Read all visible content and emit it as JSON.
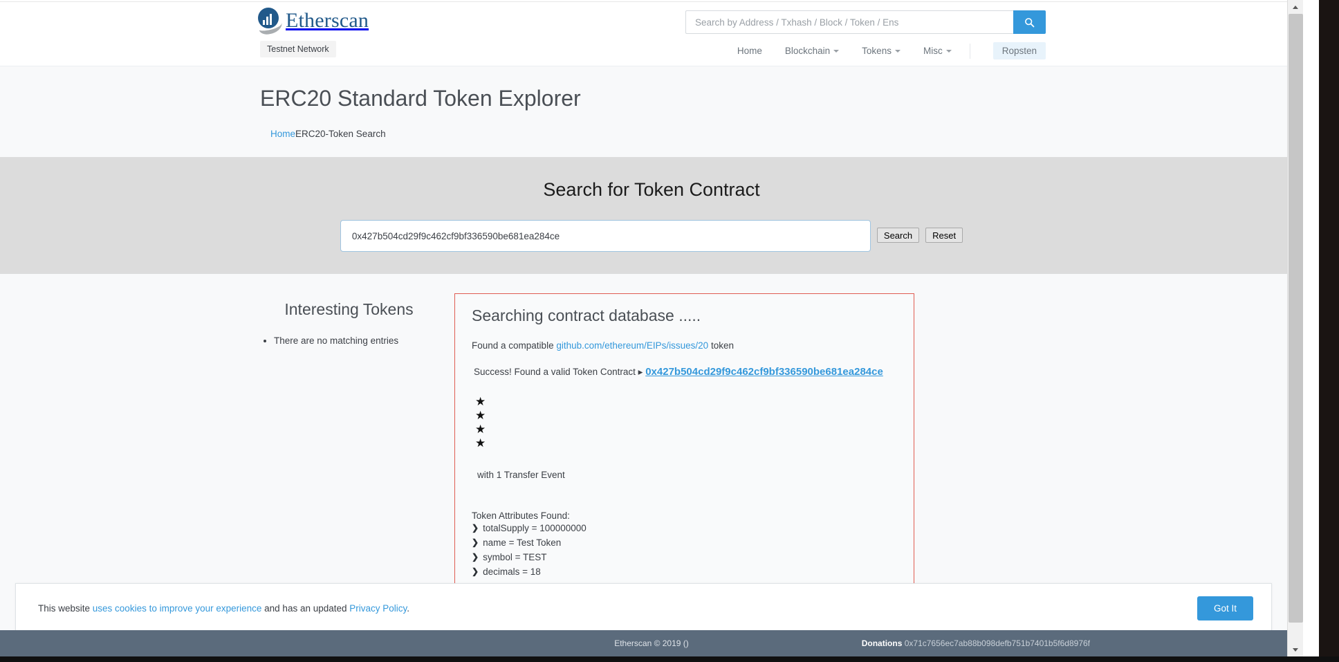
{
  "header": {
    "logo_text": "Etherscan",
    "testnet_badge": "Testnet Network",
    "search_placeholder": "Search by Address / Txhash / Block / Token / Ens",
    "search_value": "",
    "search_icon": "search-icon",
    "nav": [
      {
        "label": "Home",
        "has_caret": false
      },
      {
        "label": "Blockchain",
        "has_caret": true
      },
      {
        "label": "Tokens",
        "has_caret": true
      },
      {
        "label": "Misc",
        "has_caret": true
      }
    ],
    "network_badge": "Ropsten"
  },
  "title_band": {
    "page_title": "ERC20 Standard Token Explorer",
    "breadcrumb_home": "Home",
    "breadcrumb_current": "ERC20-Token Search"
  },
  "search_panel": {
    "heading": "Search for Token Contract",
    "input_value": "0x427b504cd29f9c462cf9bf336590be681ea284ce",
    "input_placeholder": "",
    "search_button": "Search",
    "reset_button": "Reset"
  },
  "interesting_tokens": {
    "heading": "Interesting Tokens",
    "items": [
      "There are no matching entries"
    ]
  },
  "result": {
    "heading": "Searching contract database .....",
    "found_prefix": "Found a compatible ",
    "found_link": "github.com/ethereum/EIPs/issues/20",
    "found_suffix": " token",
    "success_text": "Success! Found a valid Token Contract",
    "success_arrow": "▸",
    "contract_address": "0x427b504cd29f9c462cf9bf336590be681ea284ce",
    "stars": [
      "★",
      "★",
      "★",
      "★"
    ],
    "transfer_event": "with 1 Transfer Event",
    "attributes_heading": "Token Attributes Found:",
    "attributes": [
      {
        "chevron": "❯",
        "text": "totalSupply = 100000000"
      },
      {
        "chevron": "❯",
        "text": "name = Test Token"
      },
      {
        "chevron": "❯",
        "text": "symbol = TEST"
      },
      {
        "chevron": "❯",
        "text": "decimals = 18"
      }
    ]
  },
  "cookie_banner": {
    "text_1": "This website ",
    "link_1": "uses cookies to improve your experience",
    "text_2": " and has an updated ",
    "link_2": "Privacy Policy",
    "text_3": ".",
    "button": "Got It"
  },
  "footer": {
    "copyright": "Etherscan © 2019 ()",
    "donations_label": "Donations",
    "donations_address": "0x71c7656ec7ab88b098defb751b7401b5f6d8976f"
  },
  "colors": {
    "brand_blue": "#3498db",
    "logo_blue": "#21598a",
    "result_border": "#e05b51",
    "panel_grey": "#dcdcdc",
    "footer_bg": "#5b6b7c"
  }
}
